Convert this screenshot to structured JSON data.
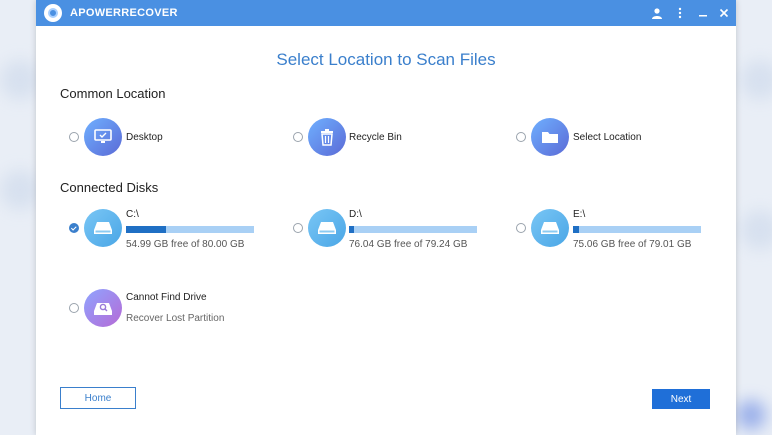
{
  "app": {
    "title": "APOWERRECOVER"
  },
  "titlebar": {
    "user_icon": "user-icon",
    "menu_icon": "more-vertical-icon",
    "minimize_icon": "minimize-icon",
    "close_icon": "close-icon"
  },
  "page": {
    "title": "Select Location to Scan Files"
  },
  "common": {
    "heading": "Common Location",
    "items": [
      {
        "label": "Desktop",
        "icon": "desktop-icon",
        "selected": false
      },
      {
        "label": "Recycle Bin",
        "icon": "recycle-bin-icon",
        "selected": false
      },
      {
        "label": "Select Location",
        "icon": "folder-icon",
        "selected": false
      }
    ]
  },
  "disks": {
    "heading": "Connected Disks",
    "items": [
      {
        "name": "C:\\",
        "free": "54.99 GB free of 80.00 GB",
        "used_fraction": 0.31,
        "selected": true,
        "icon": "drive-icon"
      },
      {
        "name": "D:\\",
        "free": "76.04 GB free of 79.24 GB",
        "used_fraction": 0.04,
        "selected": false,
        "icon": "drive-icon"
      },
      {
        "name": "E:\\",
        "free": "75.06 GB free of 79.01 GB",
        "used_fraction": 0.05,
        "selected": false,
        "icon": "drive-icon"
      }
    ],
    "lost": {
      "title": "Cannot Find Drive",
      "subtitle": "Recover Lost Partition",
      "icon": "drive-search-icon",
      "selected": false
    }
  },
  "buttons": {
    "home": "Home",
    "next": "Next"
  },
  "colors": {
    "accent": "#3a7fcc",
    "titlebar": "#4a90e2",
    "bar_fill": "#1f6fc4",
    "bar_track": "#a9d0f5"
  }
}
